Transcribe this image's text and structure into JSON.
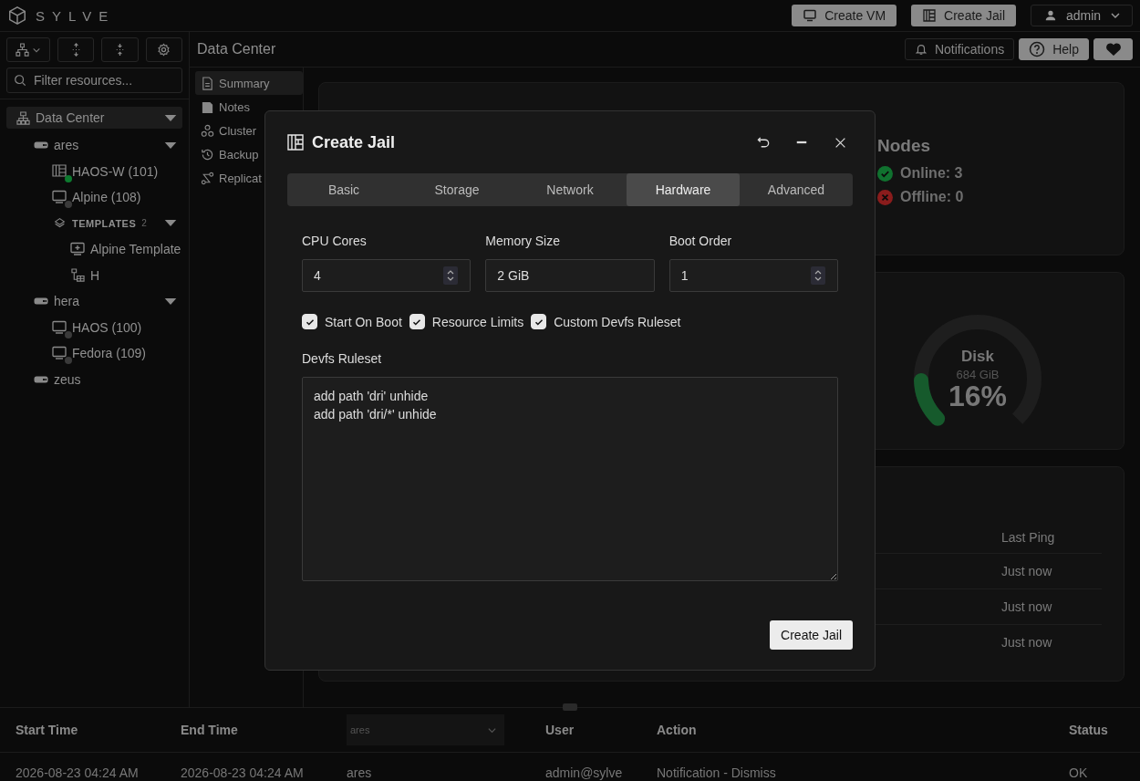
{
  "brand": {
    "name": "SYLVE"
  },
  "top_actions": [
    {
      "label": "Create VM",
      "kind": "vm"
    },
    {
      "label": "Create Jail",
      "kind": "jail"
    }
  ],
  "user_menu": {
    "label": "admin"
  },
  "sidebar": {
    "filter": {
      "placeholder": "Filter resources..."
    },
    "tree": [
      {
        "label": "Data Center",
        "kind": "datacenter",
        "selected": true,
        "expanded": true,
        "children": [
          {
            "label": "ares",
            "kind": "node",
            "selected": false,
            "expanded": true,
            "children": [
              {
                "label": "HAOS-W (101)",
                "kind": "jail",
                "selected": false,
                "running": true
              },
              {
                "label": "Alpine (108)",
                "kind": "vm",
                "selected": false,
                "running": false
              },
              {
                "label": "TEMPLATES",
                "count": "2",
                "kind": "group",
                "selected": false,
                "expanded": true,
                "children": [
                  {
                    "label": "Alpine Template",
                    "kind": "vm-template",
                    "selected": false
                  },
                  {
                    "label": "H",
                    "kind": "jail-template",
                    "selected": false
                  }
                ]
              }
            ]
          },
          {
            "label": "hera",
            "kind": "node",
            "selected": false,
            "expanded": true,
            "children": [
              {
                "label": "HAOS (100)",
                "kind": "vm",
                "selected": false,
                "running": false
              },
              {
                "label": "Fedora (109)",
                "kind": "vm",
                "selected": false,
                "running": false
              }
            ]
          },
          {
            "label": "zeus",
            "kind": "node",
            "selected": false
          }
        ]
      }
    ]
  },
  "header": {
    "title": "Data Center",
    "buttons": [
      {
        "label": "Notifications",
        "kind": "bell"
      },
      {
        "label": "Help",
        "kind": "help"
      },
      {
        "kind": "heart"
      }
    ]
  },
  "nav": [
    {
      "label": "Summary",
      "kind": "doc",
      "selected": true
    },
    {
      "label": "Notes",
      "kind": "notes",
      "selected": false
    },
    {
      "label": "Cluster",
      "kind": "cluster",
      "selected": false
    },
    {
      "label": "Backup",
      "kind": "backup",
      "selected": false
    },
    {
      "label": "Replicat",
      "kind": "replicate",
      "selected": false
    }
  ],
  "nodes": {
    "title": "Nodes",
    "items": [
      {
        "label": "Online: 3",
        "kind": "ok"
      },
      {
        "label": "Offline: 0",
        "kind": "error"
      }
    ]
  },
  "disk": {
    "title": "Disk",
    "size": "684 GiB",
    "reading": "16%",
    "level": 0.16
  },
  "pings": {
    "column": "Last Ping",
    "rows": [
      "Just now",
      "Just now",
      "Just now"
    ]
  },
  "modal": {
    "title": "Create Jail",
    "tabs": [
      {
        "label": "Basic",
        "selected": false
      },
      {
        "label": "Storage",
        "selected": false
      },
      {
        "label": "Network",
        "selected": false
      },
      {
        "label": "Hardware",
        "selected": true
      },
      {
        "label": "Advanced",
        "selected": false
      }
    ],
    "fields": [
      {
        "label": "CPU Cores",
        "value": "4",
        "kind": "number"
      },
      {
        "label": "Memory Size",
        "value": "2 GiB",
        "kind": "text"
      },
      {
        "label": "Boot Order",
        "value": "1",
        "kind": "number"
      }
    ],
    "options": [
      {
        "label": "Start On Boot",
        "checked": true
      },
      {
        "label": "Resource Limits",
        "checked": true
      },
      {
        "label": "Custom Devfs Ruleset",
        "checked": true
      }
    ],
    "ruleset": {
      "label": "Devfs Ruleset",
      "value": "add path 'dri' unhide\nadd path 'dri/*' unhide"
    },
    "submit": "Create Jail"
  },
  "log": {
    "columns": [
      {
        "kind": "text",
        "label": "Start Time"
      },
      {
        "kind": "text",
        "label": "End Time"
      },
      {
        "kind": "select",
        "value": "ares"
      },
      {
        "kind": "text",
        "label": "User"
      },
      {
        "kind": "text",
        "label": "Action"
      },
      {
        "kind": "text",
        "label": "Status"
      }
    ],
    "rows": [
      [
        "2026-08-23 04:24 AM",
        "2026-08-23 04:24 AM",
        "ares",
        "admin@sylve",
        "Notification - Dismiss",
        "OK"
      ]
    ]
  }
}
